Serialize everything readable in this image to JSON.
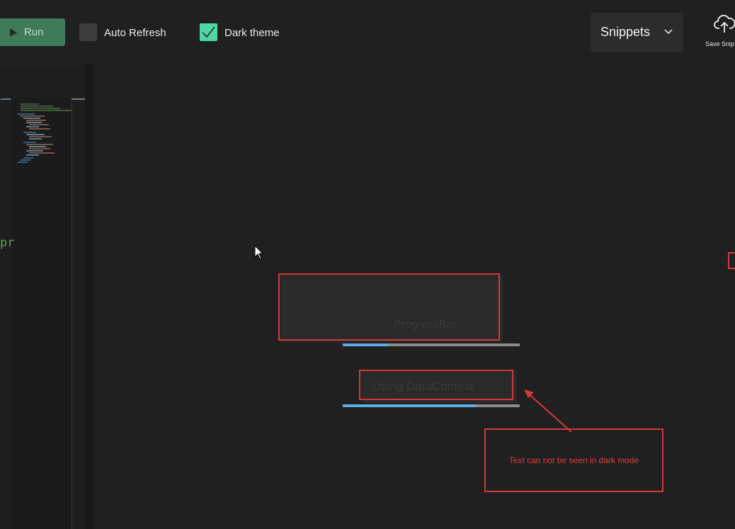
{
  "toolbar": {
    "run_label": "Run",
    "auto_refresh": {
      "label": "Auto Refresh",
      "checked": false
    },
    "dark_theme": {
      "label": "Dark theme",
      "checked": true
    },
    "snippets_label": "Snippets",
    "save_snippet_label": "Save Snip"
  },
  "editor": {
    "code_fragment": "pr"
  },
  "preview": {
    "progress_bar_1": {
      "text": "ProgressBar",
      "value_fraction": 0.25
    },
    "progress_bar_2": {
      "text": "Using DataContext",
      "value_fraction": 0.75
    },
    "annotation_text": "Text can not be seen in dark mode"
  },
  "colors": {
    "run_button": "#3f7a5a",
    "checkbox_checked": "#4fd6a4",
    "progress_fill": "#5ab0e8",
    "progress_track": "#8c8c8c",
    "annotation_red": "#d23a3a",
    "background": "#1f1f1f"
  }
}
